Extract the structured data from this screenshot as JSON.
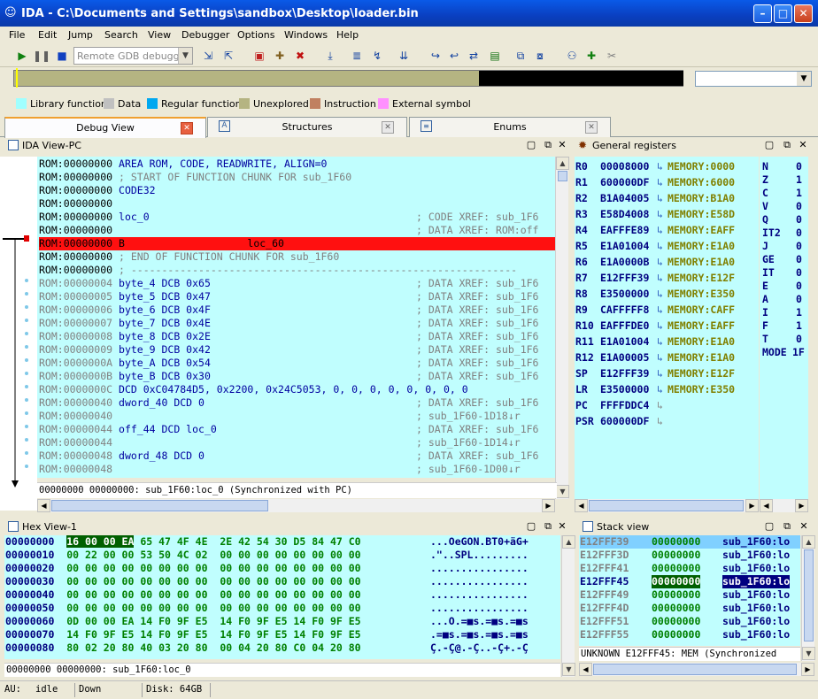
{
  "window": {
    "title": "IDA - C:\\Documents and Settings\\sandbox\\Desktop\\loader.bin"
  },
  "menu": [
    "File",
    "Edit",
    "Jump",
    "Search",
    "View",
    "Debugger",
    "Options",
    "Windows",
    "Help"
  ],
  "toolbar": {
    "debugger": "Remote GDB debugger"
  },
  "legend": [
    {
      "label": "Library function",
      "color": "#a0ffff"
    },
    {
      "label": "Data",
      "color": "#c0c0c0"
    },
    {
      "label": "Regular function",
      "color": "#00a8f0"
    },
    {
      "label": "Unexplored",
      "color": "#b5b482"
    },
    {
      "label": "Instruction",
      "color": "#c08060"
    },
    {
      "label": "External symbol",
      "color": "#ff90ff"
    }
  ],
  "tabs": [
    "Debug View",
    "Structures",
    "Enums"
  ],
  "ida_view": {
    "title": "IDA View-PC",
    "lines": [
      {
        "addr": "ROM:00000000",
        "text": " AREA ROM, CODE, READWRITE, ALIGN=0",
        "cls": "kw",
        "cmt": ""
      },
      {
        "addr": "ROM:00000000",
        "text": " ; START OF FUNCTION CHUNK FOR sub_1F60",
        "cls": "cm",
        "cmt": ""
      },
      {
        "addr": "ROM:00000000",
        "text": " CODE32",
        "cls": "kw",
        "cmt": ""
      },
      {
        "addr": "ROM:00000000",
        "text": "",
        "cls": "kw",
        "cmt": ""
      },
      {
        "addr": "ROM:00000000",
        "text": " loc_0",
        "cls": "kw",
        "cmt": "; CODE XREF: sub_1F6"
      },
      {
        "addr": "ROM:00000000",
        "text": "",
        "cls": "kw",
        "cmt": "; DATA XREF: ROM:off"
      },
      {
        "addr": "ROM:00000000",
        "text": " B                    loc_60",
        "cls": "kw",
        "cmt": "",
        "hl": true
      },
      {
        "addr": "ROM:00000000",
        "text": " ; END OF FUNCTION CHUNK FOR sub_1F60",
        "cls": "cm",
        "cmt": ""
      },
      {
        "addr": "ROM:00000000",
        "text": " ; ---------------------------------------------------------------",
        "cls": "cm",
        "cmt": ""
      },
      {
        "addr": "ROM:00000004",
        "text": " byte_4 DCB 0x65",
        "cls": "kw",
        "cmt": "; DATA XREF: sub_1F6",
        "g": true
      },
      {
        "addr": "ROM:00000005",
        "text": " byte_5 DCB 0x47",
        "cls": "kw",
        "cmt": "; DATA XREF: sub_1F6",
        "g": true
      },
      {
        "addr": "ROM:00000006",
        "text": " byte_6 DCB 0x4F",
        "cls": "kw",
        "cmt": "; DATA XREF: sub_1F6",
        "g": true
      },
      {
        "addr": "ROM:00000007",
        "text": " byte_7 DCB 0x4E",
        "cls": "kw",
        "cmt": "; DATA XREF: sub_1F6",
        "g": true
      },
      {
        "addr": "ROM:00000008",
        "text": " byte_8 DCB 0x2E",
        "cls": "kw",
        "cmt": "; DATA XREF: sub_1F6",
        "g": true
      },
      {
        "addr": "ROM:00000009",
        "text": " byte_9 DCB 0x42",
        "cls": "kw",
        "cmt": "; DATA XREF: sub_1F6",
        "g": true
      },
      {
        "addr": "ROM:0000000A",
        "text": " byte_A DCB 0x54",
        "cls": "kw",
        "cmt": "; DATA XREF: sub_1F6",
        "g": true
      },
      {
        "addr": "ROM:0000000B",
        "text": " byte_B DCB 0x30",
        "cls": "kw",
        "cmt": "; DATA XREF: sub_1F6",
        "g": true
      },
      {
        "addr": "ROM:0000000C",
        "text": " DCD 0xC04784D5, 0x2200, 0x24C5053, 0, 0, 0, 0, 0, 0, 0, 0",
        "cls": "kw",
        "cmt": "",
        "g": true
      },
      {
        "addr": "ROM:00000040",
        "text": " dword_40 DCD 0",
        "cls": "kw",
        "cmt": "; DATA XREF: sub_1F6",
        "g": true
      },
      {
        "addr": "ROM:00000040",
        "text": "",
        "cls": "kw",
        "cmt": "; sub_1F60-1D18↓r",
        "g": true
      },
      {
        "addr": "ROM:00000044",
        "text": " off_44 DCD loc_0",
        "cls": "kw",
        "cmt": "; DATA XREF: sub_1F6",
        "g": true
      },
      {
        "addr": "ROM:00000044",
        "text": "",
        "cls": "kw",
        "cmt": "; sub_1F60-1D14↓r",
        "g": true
      },
      {
        "addr": "ROM:00000048",
        "text": " dword_48 DCD 0",
        "cls": "kw",
        "cmt": "; DATA XREF: sub_1F6",
        "g": true
      },
      {
        "addr": "ROM:00000048",
        "text": "",
        "cls": "kw",
        "cmt": "; sub_1F60-1D00↓r",
        "g": true
      }
    ],
    "status": "00000000 00000000: sub_1F60:loc_0 (Synchronized with PC)"
  },
  "registers": {
    "title": "General registers",
    "rows": [
      {
        "name": "R0",
        "value": "00008000",
        "mem": "MEMORY:0000"
      },
      {
        "name": "R1",
        "value": "600000DF",
        "mem": "MEMORY:6000"
      },
      {
        "name": "R2",
        "value": "B1A04005",
        "mem": "MEMORY:B1A0"
      },
      {
        "name": "R3",
        "value": "E58D4008",
        "mem": "MEMORY:E58D"
      },
      {
        "name": "R4",
        "value": "EAFFFE89",
        "mem": "MEMORY:EAFF"
      },
      {
        "name": "R5",
        "value": "E1A01004",
        "mem": "MEMORY:E1A0"
      },
      {
        "name": "R6",
        "value": "E1A0000B",
        "mem": "MEMORY:E1A0"
      },
      {
        "name": "R7",
        "value": "E12FFF39",
        "mem": "MEMORY:E12F"
      },
      {
        "name": "R8",
        "value": "E3500000",
        "mem": "MEMORY:E350"
      },
      {
        "name": "R9",
        "value": "CAFFFFF8",
        "mem": "MEMORY:CAFF"
      },
      {
        "name": "R10",
        "value": "EAFFFDE0",
        "mem": "MEMORY:EAFF"
      },
      {
        "name": "R11",
        "value": "E1A01004",
        "mem": "MEMORY:E1A0"
      },
      {
        "name": "R12",
        "value": "E1A00005",
        "mem": "MEMORY:E1A0"
      },
      {
        "name": "SP",
        "value": "E12FFF39",
        "mem": "MEMORY:E12F"
      },
      {
        "name": "LR",
        "value": "E3500000",
        "mem": "MEMORY:E350"
      },
      {
        "name": "PC",
        "value": "FFFFDDC4",
        "mem": ""
      },
      {
        "name": "PSR",
        "value": "600000DF",
        "mem": ""
      }
    ],
    "flags": [
      {
        "n": "N",
        "v": "0"
      },
      {
        "n": "Z",
        "v": "1"
      },
      {
        "n": "C",
        "v": "1"
      },
      {
        "n": "V",
        "v": "0"
      },
      {
        "n": "Q",
        "v": "0"
      },
      {
        "n": "IT2",
        "v": "0"
      },
      {
        "n": "J",
        "v": "0"
      },
      {
        "n": "GE",
        "v": "0"
      },
      {
        "n": "IT",
        "v": "0"
      },
      {
        "n": "E",
        "v": "0"
      },
      {
        "n": "A",
        "v": "0"
      },
      {
        "n": "I",
        "v": "1"
      },
      {
        "n": "F",
        "v": "1"
      },
      {
        "n": "T",
        "v": "0"
      },
      {
        "n": "MODE",
        "v": "1F"
      }
    ]
  },
  "hex_view": {
    "title": "Hex View-1",
    "rows": [
      {
        "a": "00000000",
        "b1": "16 00 00 EA",
        "b2": " 65 47 4F 4E  2E 42 54 30 D5 84 47 C0",
        "c": "...OeGON.BT0+äG+"
      },
      {
        "a": "00000010",
        "b1": "00 22 00 00",
        "b2": " 53 50 4C 02  00 00 00 00 00 00 00 00",
        "c": ".\"..SPL........."
      },
      {
        "a": "00000020",
        "b1": "00 00 00 00",
        "b2": " 00 00 00 00  00 00 00 00 00 00 00 00",
        "c": "................"
      },
      {
        "a": "00000030",
        "b1": "00 00 00 00",
        "b2": " 00 00 00 00  00 00 00 00 00 00 00 00",
        "c": "................"
      },
      {
        "a": "00000040",
        "b1": "00 00 00 00",
        "b2": " 00 00 00 00  00 00 00 00 00 00 00 00",
        "c": "................"
      },
      {
        "a": "00000050",
        "b1": "00 00 00 00",
        "b2": " 00 00 00 00  00 00 00 00 00 00 00 00",
        "c": "................"
      },
      {
        "a": "00000060",
        "b1": "0D 00 00 EA",
        "b2": " 14 F0 9F E5  14 F0 9F E5 14 F0 9F E5",
        "c": "...O.=■s.=■s.=■s"
      },
      {
        "a": "00000070",
        "b1": "14 F0 9F E5",
        "b2": " 14 F0 9F E5  14 F0 9F E5 14 F0 9F E5",
        "c": ".=■s.=■s.=■s.=■s"
      },
      {
        "a": "00000080",
        "b1": "80 02 20 80",
        "b2": " 40 03 20 80  00 04 20 80 C0 04 20 80",
        "c": "Ç.-Ç@.-Ç..-Ç+.-Ç"
      }
    ],
    "status": "00000000 00000000: sub_1F60:loc_0"
  },
  "stack_view": {
    "title": "Stack view",
    "rows": [
      {
        "a": "E12FFF39",
        "v": "00000000",
        "s": "sub_1F60:lo"
      },
      {
        "a": "E12FFF3D",
        "v": "00000000",
        "s": "sub_1F60:lo"
      },
      {
        "a": "E12FFF41",
        "v": "00000000",
        "s": "sub_1F60:lo"
      },
      {
        "a": "E12FFF45",
        "v": "00000000",
        "s": "sub_1F60:lo"
      },
      {
        "a": "E12FFF49",
        "v": "00000000",
        "s": "sub_1F60:lo"
      },
      {
        "a": "E12FFF4D",
        "v": "00000000",
        "s": "sub_1F60:lo"
      },
      {
        "a": "E12FFF51",
        "v": "00000000",
        "s": "sub_1F60:lo"
      },
      {
        "a": "E12FFF55",
        "v": "00000000",
        "s": "sub_1F60:lo"
      }
    ],
    "status": "UNKNOWN E12FFF45: MEM (Synchronized"
  },
  "statusbar": {
    "au": "AU:",
    "state": "idle",
    "dir": "Down",
    "disk": "Disk: 64GB"
  }
}
